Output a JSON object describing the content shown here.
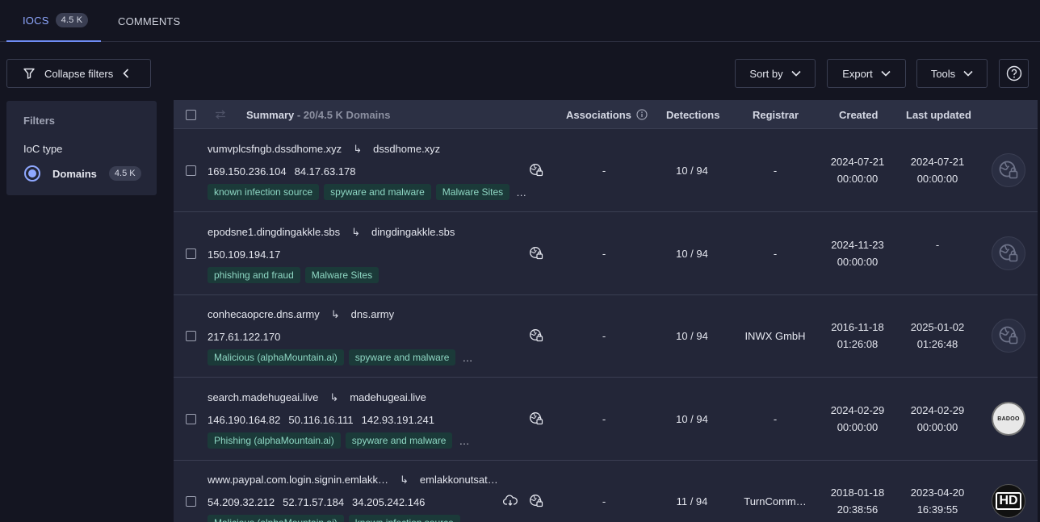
{
  "tabs": [
    {
      "label": "IOCS",
      "badge": "4.5 K"
    },
    {
      "label": "COMMENTS"
    }
  ],
  "toolbar": {
    "collapse_label": "Collapse filters",
    "sort_label": "Sort by",
    "export_label": "Export",
    "tools_label": "Tools"
  },
  "filters": {
    "title": "Filters",
    "ioc_type_label": "IoC type",
    "option_label": "Domains",
    "option_count": "4.5 K"
  },
  "table": {
    "summary_label": "Summary",
    "summary_count": " - 20/4.5 K Domains",
    "associations_label": "Associations",
    "detections_label": "Detections",
    "registrar_label": "Registrar",
    "created_label": "Created",
    "updated_label": "Last updated"
  },
  "rows": [
    {
      "domain": "vumvplcsfngb.dssdhome.xyz",
      "parent": "dssdhome.xyz",
      "ips": [
        "169.150.236.104",
        "84.17.63.178"
      ],
      "tags": [
        "known infection source",
        "spyware and malware",
        "Malware Sites"
      ],
      "more": "…",
      "associations": "-",
      "detections": "10 / 94",
      "registrar": "-",
      "created_date": "2024-07-21",
      "created_time": "00:00:00",
      "updated_date": "2024-07-21",
      "updated_time": "00:00:00",
      "avatar": "globe-icon"
    },
    {
      "domain": "epodsne1.dingdingakkle.sbs",
      "parent": "dingdingakkle.sbs",
      "ips": [
        "150.109.194.17"
      ],
      "tags": [
        "phishing and fraud",
        "Malware Sites"
      ],
      "more": "",
      "associations": "-",
      "detections": "10 / 94",
      "registrar": "-",
      "created_date": "2024-11-23",
      "created_time": "00:00:00",
      "updated_date": "-",
      "updated_time": "",
      "avatar": "globe-icon"
    },
    {
      "domain": "conhecaopcre.dns.army",
      "parent": "dns.army",
      "ips": [
        "217.61.122.170"
      ],
      "tags": [
        "Malicious (alphaMountain.ai)",
        "spyware and malware"
      ],
      "more": "…",
      "associations": "-",
      "detections": "10 / 94",
      "registrar": "INWX GmbH",
      "created_date": "2016-11-18",
      "created_time": "01:26:08",
      "updated_date": "2025-01-02",
      "updated_time": "01:26:48",
      "avatar": "globe-icon"
    },
    {
      "domain": "search.madehugeai.live",
      "parent": "madehugeai.live",
      "ips": [
        "146.190.164.82",
        "50.116.16.111",
        "142.93.191.241"
      ],
      "tags": [
        "Phishing (alphaMountain.ai)",
        "spyware and malware"
      ],
      "more": "…",
      "associations": "-",
      "detections": "10 / 94",
      "registrar": "-",
      "created_date": "2024-02-29",
      "created_time": "00:00:00",
      "updated_date": "2024-02-29",
      "updated_time": "00:00:00",
      "avatar": "badoo-logo",
      "avatar_text": "BADOO"
    },
    {
      "domain": "www.paypal.com.login.signin.emlakk…",
      "parent": "emlakkonutsat…",
      "ips": [
        "54.209.32.212",
        "52.71.57.184",
        "34.205.242.146"
      ],
      "tags": [
        "Malicious (alphaMountain.ai)",
        "known infection source"
      ],
      "more": "",
      "associations": "-",
      "detections": "11 / 94",
      "registrar": "TurnComm…",
      "created_date": "2018-01-18",
      "created_time": "20:38:56",
      "updated_date": "2023-04-20",
      "updated_time": "16:39:55",
      "avatar": "hd-logo",
      "avatar_text": "HD"
    }
  ]
}
